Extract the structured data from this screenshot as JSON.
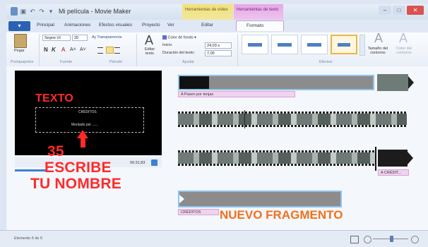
{
  "window": {
    "title": "Mi película - Movie Maker",
    "contextual_video": "Herramientas de vídeo",
    "contextual_text": "Herramientas de texto",
    "controls": [
      "–",
      "□",
      "✕"
    ]
  },
  "tabs": {
    "file": "▾",
    "items": [
      "Principal",
      "Animaciones",
      "Efectos visuales",
      "Proyecto",
      "Ver",
      "Editar",
      "Formato"
    ],
    "active": "Formato"
  },
  "ribbon": {
    "clipboard": {
      "paste": "Pegar",
      "group": "Portapapeles"
    },
    "font": {
      "family": "Segoe UI",
      "size": "20",
      "transparency": "Transparencia",
      "bold": "N",
      "italic": "K",
      "color": "A",
      "grow": "A˄",
      "shrink": "A˅",
      "group": "Fuente"
    },
    "paragraph": {
      "group": "Párrafo"
    },
    "adjust": {
      "edit_text": "Editar texto",
      "bg_color": "Color de fondo",
      "start_label": "Inicio:",
      "start_value": "24,03 s",
      "duration_label": "Duración del texto:",
      "duration_value": "7,00",
      "group": "Ajustar"
    },
    "effects": {
      "outline_size": "Tamaño del contorno",
      "outline_color": "Color del contorno",
      "group": "Efectos"
    }
  },
  "preview": {
    "credits_text": "CRÉDITOS",
    "edited_text": "Montado por ......",
    "time": "00:31,83"
  },
  "annotations": {
    "texto": "TEXTO",
    "number": "35",
    "line1": "ESCRIBE",
    "line2": "TU NOMBRE",
    "nuevo": "NUEVO FRAGMENTO"
  },
  "timeline": {
    "caption1": "Pasen por tenjas",
    "caption2": "CRÉDIT...",
    "credits_label": "CRÉDITOS"
  },
  "status": {
    "item": "Elemento 6 de 6"
  }
}
